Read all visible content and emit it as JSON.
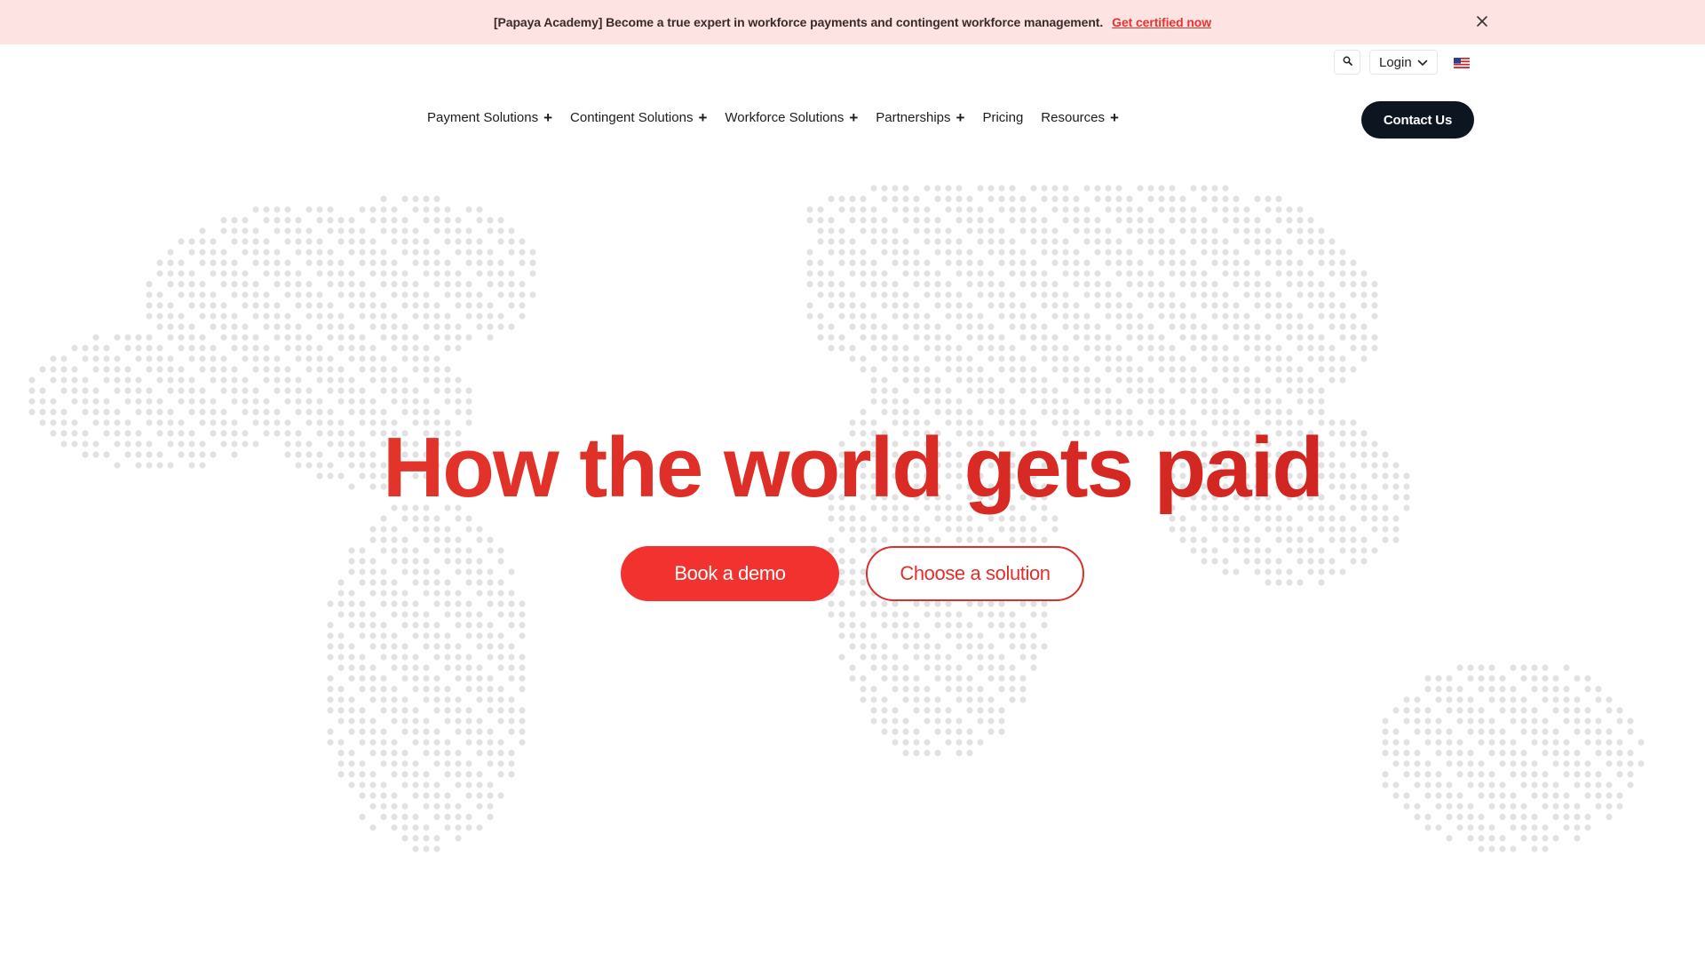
{
  "announcement": {
    "message": "[Papaya Academy] Become a true expert in workforce payments and contingent workforce management.",
    "link_label": "Get certified now",
    "close_icon": "close-icon"
  },
  "utility": {
    "search_icon": "search-icon",
    "login_label": "Login",
    "language_icon": "us-flag-icon"
  },
  "nav": {
    "items": [
      {
        "label": "Payment Solutions",
        "expandable": true
      },
      {
        "label": "Contingent Solutions",
        "expandable": true
      },
      {
        "label": "Workforce Solutions",
        "expandable": true
      },
      {
        "label": "Partnerships",
        "expandable": true
      },
      {
        "label": "Pricing",
        "expandable": false
      },
      {
        "label": "Resources",
        "expandable": true
      }
    ],
    "plus_glyph": "+",
    "contact_label": "Contact Us"
  },
  "hero": {
    "title": "How the world gets paid",
    "primary_cta": "Book a demo",
    "secondary_cta": "Choose a solution"
  },
  "colors": {
    "accent": "#f2322f",
    "title_red": "#e02a26",
    "announce_bg": "#fde4e2",
    "dark": "#0d1620",
    "map_dot": "#d9d9d9"
  }
}
